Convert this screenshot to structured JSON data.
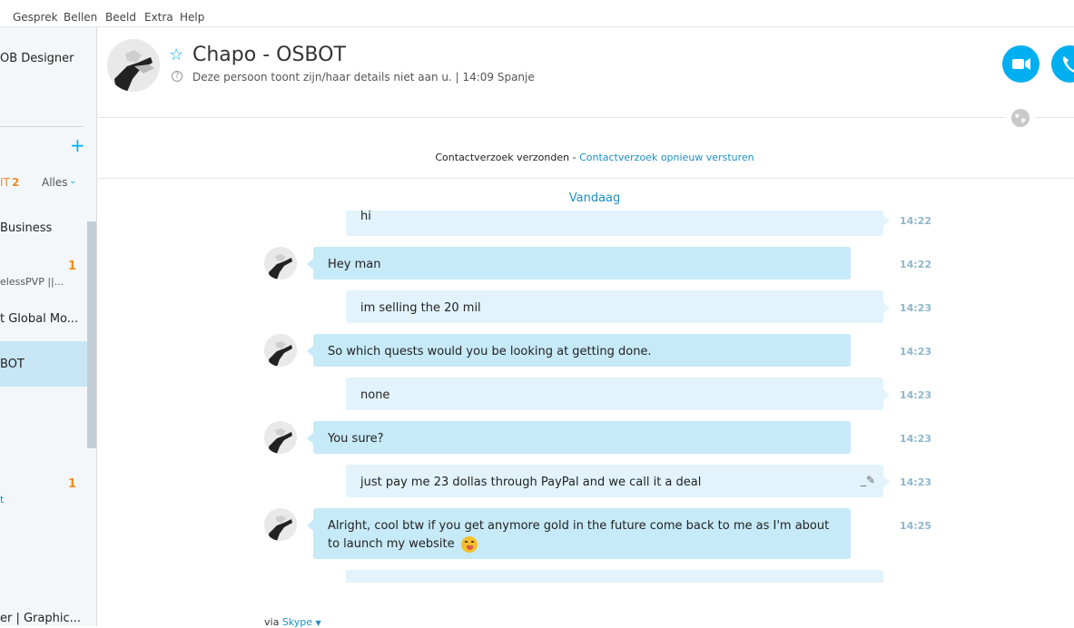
{
  "menu": [
    "Gesprek",
    "Bellen",
    "Beeld",
    "Extra",
    "Help"
  ],
  "sidebar": {
    "top_item": "OB Designer",
    "add_icon": "plus-icon",
    "recent_label": "IT",
    "recent_count": "2",
    "filter_label": "Alles",
    "items": [
      {
        "label": "Business",
        "badge": ""
      },
      {
        "label": "elessPVP ||...",
        "badge": "1"
      },
      {
        "label": "t Global Mo...",
        "badge": ""
      },
      {
        "label": "BOT",
        "badge": ""
      },
      {
        "label": "t",
        "badge": "1"
      },
      {
        "label": "er | Graphic...",
        "badge": ""
      }
    ]
  },
  "header": {
    "title": "Chapo - OSBOT",
    "subtitle": "Deze persoon toont zijn/haar details niet aan u.  |  14:09 Spanje"
  },
  "notice": {
    "text": "Contactverzoek verzonden - ",
    "link": "Contactverzoek opnieuw versturen"
  },
  "date_label": "Vandaag",
  "messages": [
    {
      "dir": "out",
      "text": "hi",
      "time": "14:22"
    },
    {
      "dir": "in",
      "text": "Hey man",
      "time": "14:22"
    },
    {
      "dir": "out",
      "text": "im selling the 20 mil",
      "time": "14:23"
    },
    {
      "dir": "in",
      "text": "So which quests would you be looking at getting done.",
      "time": "14:23"
    },
    {
      "dir": "out",
      "text": "none",
      "time": "14:23"
    },
    {
      "dir": "in",
      "text": "You sure?",
      "time": "14:23"
    },
    {
      "dir": "out",
      "text": "just pay me 23 dollas through PayPal and we call it a deal",
      "time": "14:23"
    },
    {
      "dir": "in",
      "text": "Alright, cool btw if you get anymore gold in the future come back to me as I'm  about to launch my website",
      "time": "14:25"
    }
  ],
  "footer": {
    "via_label": "via",
    "via_link": "Skype"
  },
  "colors": {
    "accent": "#00aff0",
    "bubble_in": "#c7eaf8",
    "bubble_out": "#e2f3fb",
    "badge": "#f08c1e"
  }
}
